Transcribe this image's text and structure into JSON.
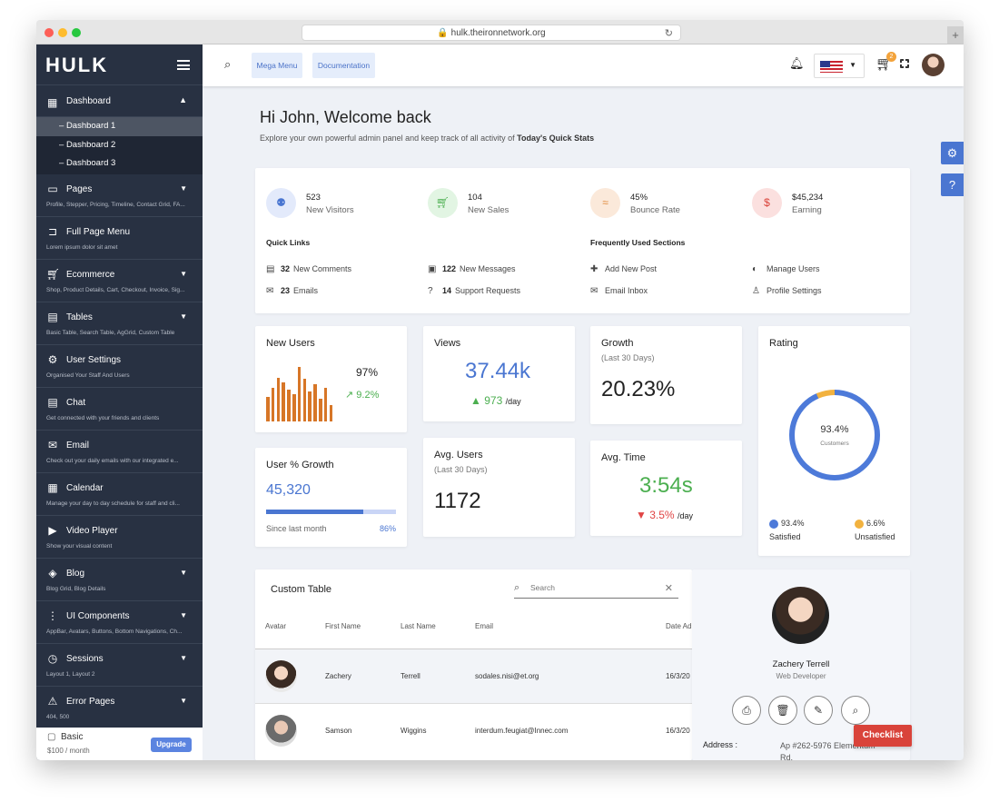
{
  "browser": {
    "url": "hulk.theironnetwork.org",
    "reload_icon": "reload-icon",
    "new_tab_icon": "plus-icon"
  },
  "sidebar": {
    "logo": "HULK",
    "dashboard": {
      "label": "Dashboard",
      "icon": "dashboard-grid-icon",
      "subitems": [
        "Dashboard 1",
        "Dashboard 2",
        "Dashboard 3"
      ],
      "active_index": 0
    },
    "items": [
      {
        "label": "Pages",
        "desc": "Profile, Stepper, Pricing, Timeline, Contact Grid, FA...",
        "icon": "pages-icon",
        "caret": true
      },
      {
        "label": "Full Page Menu",
        "desc": "Lorem ipsum dolor sit amet",
        "icon": "label-icon",
        "caret": false
      },
      {
        "label": "Ecommerce",
        "desc": "Shop, Product Details, Cart, Checkout, Invoice, Sig...",
        "icon": "cart-icon",
        "caret": true
      },
      {
        "label": "Tables",
        "desc": "Basic Table, Search Table, AgGrid, Custom Table",
        "icon": "table-icon",
        "caret": true
      },
      {
        "label": "User Settings",
        "desc": "Organised Your Staff And Users",
        "icon": "user-settings-icon",
        "caret": false
      },
      {
        "label": "Chat",
        "desc": "Get connected with your friends and clients",
        "icon": "chat-icon",
        "caret": false
      },
      {
        "label": "Email",
        "desc": "Check out your daily emails with our integrated e...",
        "icon": "email-icon",
        "caret": false
      },
      {
        "label": "Calendar",
        "desc": "Manage your day to day schedule for staff and cli...",
        "icon": "calendar-icon",
        "caret": false
      },
      {
        "label": "Video Player",
        "desc": "Show your visual content",
        "icon": "play-icon",
        "caret": false
      },
      {
        "label": "Blog",
        "desc": "Blog Grid, Blog Details",
        "icon": "layers-icon",
        "caret": true
      },
      {
        "label": "UI Components",
        "desc": "AppBar, Avatars, Buttons, Bottom Navigations, Ch...",
        "icon": "apps-icon",
        "caret": true
      },
      {
        "label": "Sessions",
        "desc": "Layout 1, Layout 2",
        "icon": "clock-icon",
        "caret": true
      },
      {
        "label": "Error Pages",
        "desc": "404, 500",
        "icon": "error-icon",
        "caret": true
      }
    ],
    "plan": {
      "name": "Basic",
      "price": "$100 / month",
      "upgrade": "Upgrade"
    }
  },
  "topbar": {
    "mega_menu": "Mega Menu",
    "documentation": "Documentation",
    "cart_count": "2"
  },
  "welcome": {
    "title": "Hi John, Welcome back",
    "subtitle": "Explore your own powerful admin panel and keep track of all activity of",
    "subtitle_bold": "Today's Quick Stats"
  },
  "stats": [
    {
      "value": "523",
      "label": "New Visitors",
      "color": "#4a76d1",
      "bg": "#e3eafb",
      "icon": "users-icon"
    },
    {
      "value": "104",
      "label": "New Sales",
      "color": "#4caf50",
      "bg": "#e2f5e3",
      "icon": "cart-icon"
    },
    {
      "value": "45%",
      "label": "Bounce Rate",
      "color": "#e08a3c",
      "bg": "#fbe9da",
      "icon": "bounce-icon"
    },
    {
      "value": "$45,234",
      "label": "Earning",
      "color": "#d9433a",
      "bg": "#fbe0df",
      "icon": "dollar-icon"
    }
  ],
  "quick_links": {
    "title": "Quick Links",
    "items": [
      {
        "count": "32",
        "label": "New Comments",
        "icon": "comment-icon"
      },
      {
        "count": "122",
        "label": "New Messages",
        "icon": "message-icon"
      },
      {
        "count": "23",
        "label": "Emails",
        "icon": "email-icon"
      },
      {
        "count": "14",
        "label": "Support Requests",
        "icon": "help-icon"
      }
    ]
  },
  "frequent": {
    "title": "Frequently Used Sections",
    "items": [
      {
        "label": "Add New Post",
        "icon": "add-post-icon"
      },
      {
        "label": "Manage Users",
        "icon": "manage-users-icon"
      },
      {
        "label": "Email Inbox",
        "icon": "email-icon"
      },
      {
        "label": "Profile Settings",
        "icon": "person-icon"
      }
    ]
  },
  "new_users": {
    "title": "New Users",
    "percent": "97%",
    "change": "9.2%",
    "bars": [
      0.45,
      0.62,
      0.8,
      0.72,
      0.58,
      0.5,
      1.0,
      0.78,
      0.55,
      0.68,
      0.42,
      0.62,
      0.3
    ]
  },
  "views": {
    "title": "Views",
    "value": "37.44k",
    "per_day": "973",
    "unit": "/day"
  },
  "growth": {
    "title": "Growth",
    "sub": "(Last 30 Days)",
    "value": "20.23%"
  },
  "rating": {
    "title": "Rating",
    "value": "93.4%",
    "label": "Customers",
    "satisfied": "93.4%",
    "satisfied_label": "Satisfied",
    "unsatisfied": "6.6%",
    "unsatisfied_label": "Unsatisfied",
    "satisfied_color": "#4d7ad9",
    "unsatisfied_color": "#f2b23f"
  },
  "user_growth": {
    "title": "User % Growth",
    "value": "45,320",
    "since": "Since last month",
    "percent": "86%",
    "progress": 0.75
  },
  "avg_users": {
    "title": "Avg. Users",
    "sub": "(Last 30 Days)",
    "value": "1172"
  },
  "avg_time": {
    "title": "Avg. Time",
    "value": "3:54s",
    "change": "3.5%",
    "unit": "/day"
  },
  "table": {
    "title": "Custom Table",
    "search_placeholder": "Search",
    "columns": [
      "Avatar",
      "First Name",
      "Last Name",
      "Email",
      "Date Ad"
    ],
    "rows": [
      {
        "first": "Zachery",
        "last": "Terrell",
        "email": "sodales.nisi@et.org",
        "date": "16/3/20"
      },
      {
        "first": "Samson",
        "last": "Wiggins",
        "email": "interdum.feugiat@Innec.com",
        "date": "16/3/20"
      }
    ]
  },
  "profile": {
    "name": "Zachery Terrell",
    "role": "Web Developer",
    "address_label": "Address :",
    "address": "Ap #262-5976 Elementum Rd.",
    "actions": [
      "print-icon",
      "delete-icon",
      "edit-icon",
      "view-icon"
    ]
  },
  "checklist": "Checklist"
}
